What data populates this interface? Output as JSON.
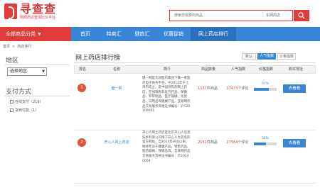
{
  "header": {
    "logo_text": "寻查查",
    "logo_sub": "网购药店查询比价平台",
    "search_placeholder": "搜索您需要的商品",
    "search_scope": "东网药店"
  },
  "nav": {
    "category_label": "全部商品分类",
    "items": [
      {
        "label": "首页"
      },
      {
        "label": "特卖汇"
      },
      {
        "label": "健韵汇"
      },
      {
        "label": "优惠促销"
      },
      {
        "label": "网上药店排行"
      }
    ]
  },
  "breadcrumb": [
    "首页",
    ">",
    "药店排行"
  ],
  "sidebar": {
    "region_title": "地区",
    "region_selected": "选择地区",
    "payment_title": "支付方式",
    "payment_options": [
      {
        "label": "在线支付（219）"
      },
      {
        "label": "货到付款（1）"
      }
    ]
  },
  "main": {
    "title": "网上药店排行榜",
    "sort": {
      "default": "默认",
      "popularity": "人气指数",
      "price": "价格指数"
    },
    "columns": {
      "rank": "排名",
      "name": "名称",
      "intro": "简介",
      "count": "商品数量",
      "popularity": "人气指数",
      "price_index": "价格指数",
      "buy": "购买地址"
    },
    "rows": [
      {
        "rank": "1",
        "name": "健一网",
        "intro": "健一网是华润医药集团下属一家医药电子商务平台，于2011年于上海市成立，是中国领先的网上药店，在线销售非处方药品、保健品、参茸制品、医疗器械、化妆品、日用品等健康产品，互联网药品交易服务资格证书编号：沪C20100001",
        "count_num": "1137",
        "count_unit": "件商品",
        "pop_num": "37473",
        "pop_unit": "个评论",
        "price_pct": "67%",
        "price_fraction": 0.67,
        "buy_label": "去看看"
      },
      {
        "rank": "2",
        "name": "开心人网上药店",
        "intro": "开心人网上药店是北京开心人信息技术有限公司旗下开心人大药房的官方网站，自2010年开业以来，始终专注于健康产品，销售药品、医药器械、保健品等，互联网药品交易服务资格证书编号：京20140004",
        "count_num": "2151",
        "count_unit": "件商品",
        "pop_num": "27564",
        "pop_unit": "个评论",
        "price_pct": "54%",
        "price_fraction": 0.54,
        "buy_label": "去看看"
      }
    ]
  },
  "colors": {
    "brand_red": "#e33a3a",
    "nav_blue": "#3a86d6",
    "rank_orange": "#e2532f"
  }
}
